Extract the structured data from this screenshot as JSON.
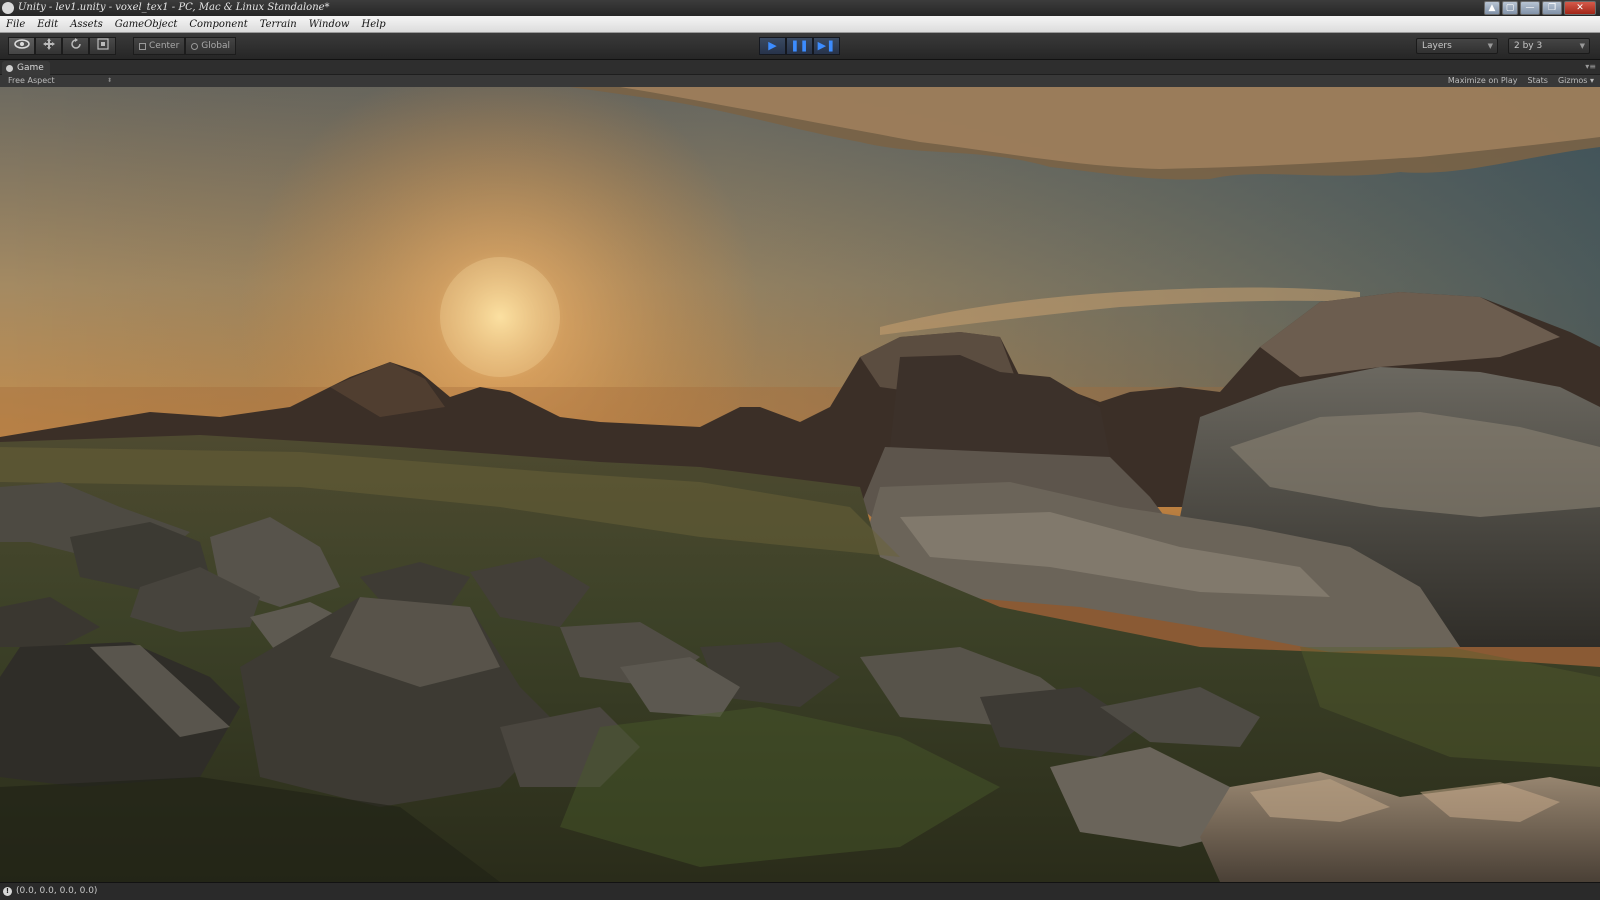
{
  "window": {
    "title": "Unity - lev1.unity - voxel_tex1 - PC, Mac & Linux Standalone*",
    "controls": [
      "▲",
      "▢",
      "—",
      "❐",
      "✕"
    ]
  },
  "menu": [
    "File",
    "Edit",
    "Assets",
    "GameObject",
    "Component",
    "Terrain",
    "Window",
    "Help"
  ],
  "toolbar": {
    "transform_tools": [
      "view-icon",
      "move-icon",
      "rotate-icon",
      "scale-icon"
    ],
    "pivot_mode": "Center",
    "pivot_rotation": "Global",
    "play_icon": "▶",
    "pause_icon": "❚❚",
    "step_icon": "▶❚",
    "layers": "Layers",
    "layout": "2 by 3"
  },
  "game_view": {
    "tab_label": "Game",
    "aspect": "Free Aspect",
    "maximize_on_play": "Maximize on Play",
    "stats": "Stats",
    "gizmos": "Gizmos"
  },
  "status": {
    "text": "(0.0, 0.0, 0.0, 0.0)"
  },
  "colors": {
    "play_accent": "#3c8cff",
    "sky_horizon": "#d48a3c",
    "sky_top": "#4d6070"
  }
}
